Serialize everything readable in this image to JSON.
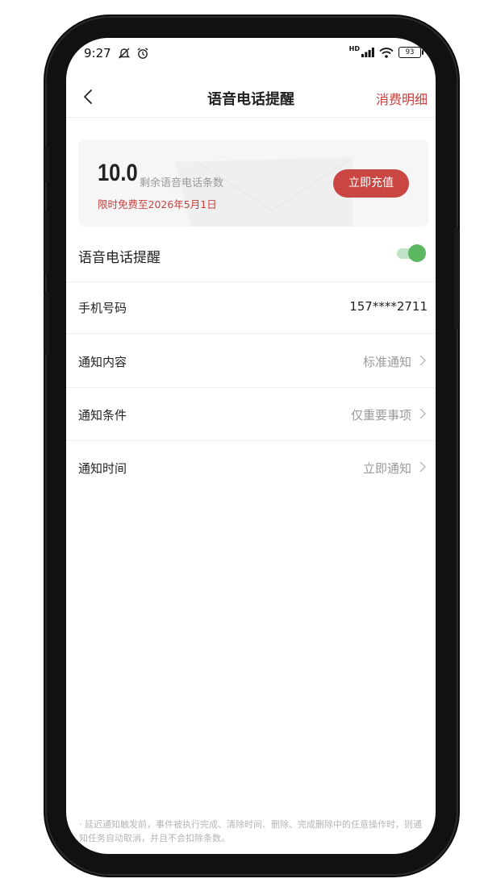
{
  "status_bar": {
    "time": "9:27",
    "network": "HD",
    "battery": "93"
  },
  "nav": {
    "title": "语音电话提醒",
    "right_link": "消费明细"
  },
  "balance_card": {
    "count": "10.0",
    "count_label": "剩余语音电话条数",
    "promo": "限时免费至2026年5月1日",
    "recharge_label": "立即充值"
  },
  "settings": {
    "voice_reminder": {
      "label": "语音电话提醒",
      "enabled": true
    },
    "phone": {
      "label": "手机号码",
      "value": "157****2711"
    },
    "content": {
      "label": "通知内容",
      "value": "标准通知"
    },
    "condition": {
      "label": "通知条件",
      "value": "仅重要事项"
    },
    "time": {
      "label": "通知时间",
      "value": "立即通知"
    }
  },
  "footnote": "· 延迟通知触发前，事件被执行完成、清除时间、删除、完成删除中的任意操作时，则通知任务自动取消，并且不会扣除条数。",
  "colors": {
    "accent_red": "#c9403e",
    "toggle_green": "#5cb860"
  }
}
